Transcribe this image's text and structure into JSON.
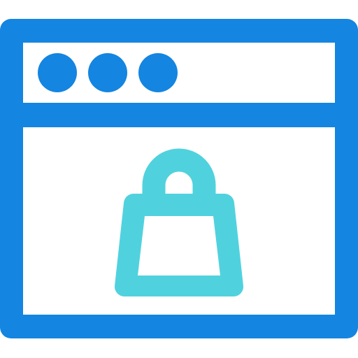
{
  "icon": {
    "name": "online-shopping-browser-icon",
    "colors": {
      "frame": "#1485E0",
      "bag": "#50D2DE",
      "background": "#FFFFFF"
    },
    "parts": {
      "frame": "browser-window-icon",
      "dots": "window-control-dots-icon",
      "bag": "shopping-bag-icon"
    },
    "window_control_dot_count": 3
  }
}
